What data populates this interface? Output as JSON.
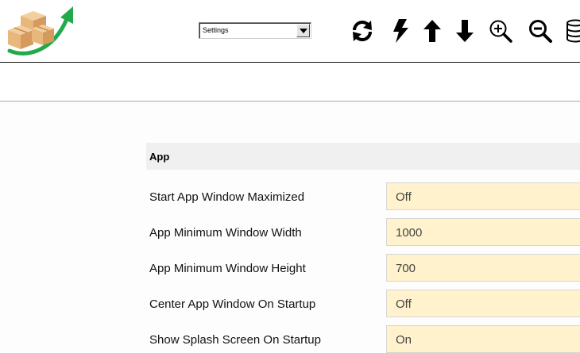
{
  "toolbar": {
    "view_select": {
      "selected": "Settings"
    },
    "icons": [
      "refresh-icon",
      "bolt-icon",
      "arrow-up-icon",
      "arrow-down-icon",
      "zoom-in-icon",
      "zoom-out-icon",
      "database-icon"
    ]
  },
  "colors": {
    "value_background": "#fff2cc",
    "section_header_background": "#f0f0f0",
    "logo_arrow": "#21a94a",
    "logo_box": "#e8b77c"
  },
  "section": {
    "title": "App",
    "settings": [
      {
        "label": "Start App Window Maximized",
        "value": "Off"
      },
      {
        "label": "App Minimum Window Width",
        "value": "1000"
      },
      {
        "label": "App Minimum Window Height",
        "value": "700"
      },
      {
        "label": "Center App Window On Startup",
        "value": "Off"
      },
      {
        "label": "Show Splash Screen On Startup",
        "value": "On"
      }
    ]
  }
}
